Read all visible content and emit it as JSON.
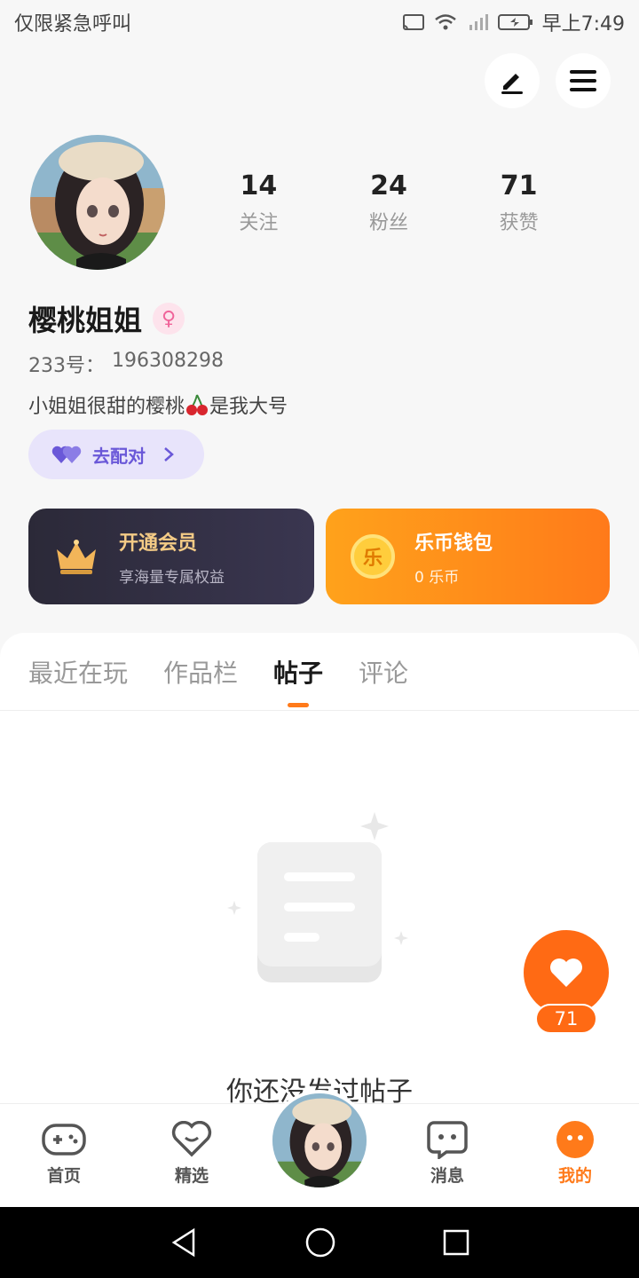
{
  "status_bar": {
    "left_text": "仅限紧急呼叫",
    "time": "早上7:49"
  },
  "profile": {
    "name": "樱桃姐姐",
    "uid_label": "233号：",
    "uid_value": "196308298",
    "bio_before": "小姐姐很甜的樱桃",
    "bio_after": "是我大号",
    "pair_button": "去配对",
    "stats": [
      {
        "num": "14",
        "label": "关注"
      },
      {
        "num": "24",
        "label": "粉丝"
      },
      {
        "num": "71",
        "label": "获赞"
      }
    ]
  },
  "cards": {
    "vip": {
      "title": "开通会员",
      "subtitle": "享海量专属权益"
    },
    "wallet": {
      "title": "乐币钱包",
      "subtitle": "0 乐币",
      "coin_glyph": "乐"
    }
  },
  "tabs": [
    {
      "label": "最近在玩"
    },
    {
      "label": "作品栏"
    },
    {
      "label": "帖子"
    },
    {
      "label": "评论"
    }
  ],
  "empty_state": {
    "text": "你还没发过帖子"
  },
  "like_fab": {
    "count": "71"
  },
  "bottom_nav": [
    {
      "label": "首页",
      "icon": "gamepad-icon"
    },
    {
      "label": "精选",
      "icon": "heart-outline-icon"
    },
    {
      "label": "消息",
      "icon": "chat-icon"
    },
    {
      "label": "我的",
      "icon": "face-icon"
    }
  ],
  "colors": {
    "accent": "#ff7a1a",
    "pair": "#6a58d8",
    "vip_gold": "#f4cb86"
  }
}
